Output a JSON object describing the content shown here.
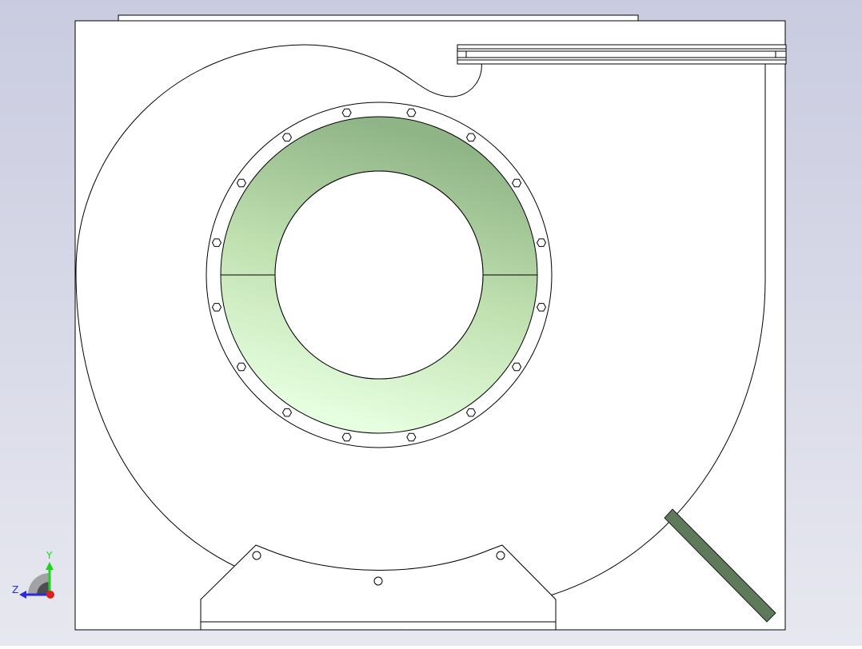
{
  "viewport": {
    "background_top": "#c9cbe0",
    "background_bottom": "#e7e8ef"
  },
  "model": {
    "sheet_fill": "#ffffff",
    "line_color": "#000000",
    "inlet_ring_colors": [
      "#8fb486",
      "#c0e0b0",
      "#e6ffe0"
    ],
    "support_strut_color": "#5e7a5a"
  },
  "triad": {
    "y_label": "Y",
    "z_label": "Z",
    "y_color": "#1fd31f",
    "z_color": "#2a2ae0",
    "x_color": "#e01f1f"
  }
}
